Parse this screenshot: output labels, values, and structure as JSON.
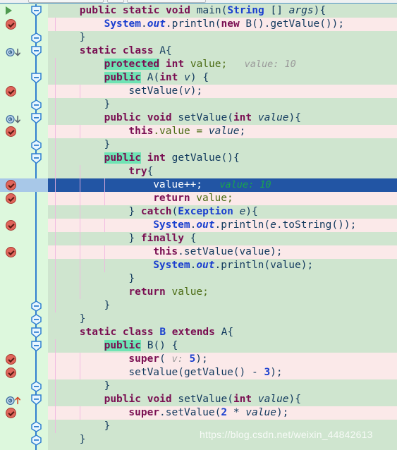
{
  "app": {
    "name": "java-code-editor",
    "theme_colors": {
      "gutter_bg": "#ddf8dd",
      "code_bg": "#cfe5cf",
      "modified_line_bg": "#fbe9e9",
      "current_line_bg": "#2255a4",
      "current_line_gutter_bg": "#a8c8e8",
      "search_highlight": "#6fe3b4",
      "indent_guide": "#f0b4e0",
      "fold_ruler": "#2f7fd0",
      "breakpoint": "#e0665c"
    }
  },
  "watermark": "https://blog.csdn.net/weixin_44842613",
  "lines": [
    {
      "n": 1,
      "indent": 1,
      "bg": "normal",
      "gutter": "run-icon",
      "fold": "collapse-end",
      "guides": 0,
      "tokens": [
        {
          "t": "public",
          "c": "kw"
        },
        {
          "t": " ",
          "c": "plain"
        },
        {
          "t": "static",
          "c": "kw"
        },
        {
          "t": " ",
          "c": "plain"
        },
        {
          "t": "void",
          "c": "kw"
        },
        {
          "t": " ",
          "c": "plain"
        },
        {
          "t": "main",
          "c": "plain"
        },
        {
          "t": "(",
          "c": "plain"
        },
        {
          "t": "String",
          "c": "type"
        },
        {
          "t": " [] ",
          "c": "plain"
        },
        {
          "t": "args",
          "c": "italic plain"
        },
        {
          "t": "){",
          "c": "plain"
        }
      ]
    },
    {
      "n": 2,
      "indent": 2,
      "bg": "pink",
      "gutter": "breakpoint-icon",
      "fold": "none",
      "guides": 1,
      "tokens": [
        {
          "t": "System",
          "c": "stat"
        },
        {
          "t": ".",
          "c": "plain"
        },
        {
          "t": "out",
          "c": "stat italic"
        },
        {
          "t": ".println(",
          "c": "plain"
        },
        {
          "t": "new",
          "c": "kw"
        },
        {
          "t": " B().getValue());",
          "c": "plain"
        }
      ]
    },
    {
      "n": 3,
      "indent": 1,
      "bg": "normal",
      "gutter": "none",
      "fold": "collapse-close",
      "guides": 0,
      "tokens": [
        {
          "t": "}",
          "c": "plain"
        }
      ]
    },
    {
      "n": 4,
      "indent": 1,
      "bg": "normal",
      "gutter": "override-down-icon",
      "fold": "collapse-end",
      "guides": 0,
      "tokens": [
        {
          "t": "static",
          "c": "kw"
        },
        {
          "t": " ",
          "c": "plain"
        },
        {
          "t": "class",
          "c": "kw"
        },
        {
          "t": " A{",
          "c": "plain"
        }
      ]
    },
    {
      "n": 5,
      "indent": 2,
      "bg": "normal",
      "gutter": "none",
      "fold": "none",
      "guides": 1,
      "tokens": [
        {
          "t": "protected",
          "c": "kw hl"
        },
        {
          "t": " ",
          "c": "plain"
        },
        {
          "t": "int",
          "c": "kw"
        },
        {
          "t": " value;",
          "c": "fld"
        },
        {
          "t": "   value: 10",
          "c": "hint"
        }
      ]
    },
    {
      "n": 6,
      "indent": 2,
      "bg": "normal",
      "gutter": "none",
      "fold": "collapse-end",
      "guides": 1,
      "tokens": [
        {
          "t": "public",
          "c": "kw hl"
        },
        {
          "t": " A(",
          "c": "plain"
        },
        {
          "t": "int",
          "c": "kw"
        },
        {
          "t": " ",
          "c": "plain"
        },
        {
          "t": "v",
          "c": "italic plain"
        },
        {
          "t": ") {",
          "c": "plain"
        }
      ]
    },
    {
      "n": 7,
      "indent": 3,
      "bg": "pink",
      "gutter": "breakpoint-icon",
      "fold": "none",
      "guides": 2,
      "tokens": [
        {
          "t": "setValue(",
          "c": "plain"
        },
        {
          "t": "v",
          "c": "italic plain"
        },
        {
          "t": ");",
          "c": "plain"
        }
      ]
    },
    {
      "n": 8,
      "indent": 2,
      "bg": "normal",
      "gutter": "none",
      "fold": "collapse-close",
      "guides": 1,
      "tokens": [
        {
          "t": "}",
          "c": "plain"
        }
      ]
    },
    {
      "n": 9,
      "indent": 2,
      "bg": "normal",
      "gutter": "override-down-icon",
      "fold": "collapse-end",
      "guides": 1,
      "tokens": [
        {
          "t": "public",
          "c": "kw"
        },
        {
          "t": " ",
          "c": "plain"
        },
        {
          "t": "void",
          "c": "kw"
        },
        {
          "t": " setValue(",
          "c": "plain"
        },
        {
          "t": "int",
          "c": "kw"
        },
        {
          "t": " ",
          "c": "plain"
        },
        {
          "t": "value",
          "c": "italic plain"
        },
        {
          "t": "){",
          "c": "plain"
        }
      ]
    },
    {
      "n": 10,
      "indent": 3,
      "bg": "pink",
      "gutter": "breakpoint-icon",
      "fold": "none",
      "guides": 2,
      "tokens": [
        {
          "t": "this",
          "c": "kw"
        },
        {
          "t": ".value = ",
          "c": "fld"
        },
        {
          "t": "value",
          "c": "italic plain"
        },
        {
          "t": ";",
          "c": "plain"
        }
      ]
    },
    {
      "n": 11,
      "indent": 2,
      "bg": "normal",
      "gutter": "none",
      "fold": "collapse-close",
      "guides": 1,
      "tokens": [
        {
          "t": "}",
          "c": "plain"
        }
      ]
    },
    {
      "n": 12,
      "indent": 2,
      "bg": "normal",
      "gutter": "none",
      "fold": "collapse-end",
      "guides": 1,
      "tokens": [
        {
          "t": "public",
          "c": "kw hl"
        },
        {
          "t": " ",
          "c": "plain"
        },
        {
          "t": "int",
          "c": "kw"
        },
        {
          "t": " getValue(){",
          "c": "plain"
        }
      ]
    },
    {
      "n": 13,
      "indent": 3,
      "bg": "normal",
      "gutter": "none",
      "fold": "none",
      "guides": 2,
      "tokens": [
        {
          "t": "try",
          "c": "kw"
        },
        {
          "t": "{",
          "c": "plain"
        }
      ]
    },
    {
      "n": 14,
      "indent": 4,
      "bg": "current",
      "gutter": "breakpoint-icon",
      "fold": "none",
      "guides": 3,
      "tokens": [
        {
          "t": "value++;",
          "c": "plain"
        },
        {
          "t": "   value: 10",
          "c": "hintg"
        }
      ]
    },
    {
      "n": 15,
      "indent": 4,
      "bg": "pink",
      "gutter": "breakpoint-icon",
      "fold": "none",
      "guides": 3,
      "tokens": [
        {
          "t": "return",
          "c": "kw"
        },
        {
          "t": " value;",
          "c": "fld"
        }
      ]
    },
    {
      "n": 16,
      "indent": 3,
      "bg": "normal",
      "gutter": "none",
      "fold": "none",
      "guides": 2,
      "tokens": [
        {
          "t": "} ",
          "c": "plain"
        },
        {
          "t": "catch",
          "c": "kw"
        },
        {
          "t": "(",
          "c": "plain"
        },
        {
          "t": "Exception",
          "c": "type"
        },
        {
          "t": " ",
          "c": "plain"
        },
        {
          "t": "e",
          "c": "italic plain"
        },
        {
          "t": "){",
          "c": "plain"
        }
      ]
    },
    {
      "n": 17,
      "indent": 4,
      "bg": "pink",
      "gutter": "breakpoint-icon",
      "fold": "none",
      "guides": 3,
      "tokens": [
        {
          "t": "System",
          "c": "stat"
        },
        {
          "t": ".",
          "c": "plain"
        },
        {
          "t": "out",
          "c": "stat italic"
        },
        {
          "t": ".println(",
          "c": "plain"
        },
        {
          "t": "e",
          "c": "italic plain"
        },
        {
          "t": ".toString());",
          "c": "plain"
        }
      ]
    },
    {
      "n": 18,
      "indent": 3,
      "bg": "normal",
      "gutter": "none",
      "fold": "none",
      "guides": 2,
      "tokens": [
        {
          "t": "} ",
          "c": "plain"
        },
        {
          "t": "finally",
          "c": "kw"
        },
        {
          "t": " {",
          "c": "plain"
        }
      ]
    },
    {
      "n": 19,
      "indent": 4,
      "bg": "pink",
      "gutter": "breakpoint-icon",
      "fold": "none",
      "guides": 3,
      "tokens": [
        {
          "t": "this",
          "c": "kw"
        },
        {
          "t": ".setValue(value);",
          "c": "plain"
        }
      ]
    },
    {
      "n": 20,
      "indent": 4,
      "bg": "normal",
      "gutter": "none",
      "fold": "none",
      "guides": 3,
      "tokens": [
        {
          "t": "System",
          "c": "stat"
        },
        {
          "t": ".",
          "c": "plain"
        },
        {
          "t": "out",
          "c": "stat italic"
        },
        {
          "t": ".println(value);",
          "c": "plain"
        }
      ]
    },
    {
      "n": 21,
      "indent": 3,
      "bg": "normal",
      "gutter": "none",
      "fold": "none",
      "guides": 2,
      "tokens": [
        {
          "t": "}",
          "c": "plain"
        }
      ]
    },
    {
      "n": 22,
      "indent": 3,
      "bg": "normal",
      "gutter": "none",
      "fold": "none",
      "guides": 2,
      "tokens": [
        {
          "t": "return",
          "c": "kw"
        },
        {
          "t": " value;",
          "c": "fld"
        }
      ]
    },
    {
      "n": 23,
      "indent": 2,
      "bg": "normal",
      "gutter": "none",
      "fold": "collapse-close",
      "guides": 1,
      "tokens": [
        {
          "t": "}",
          "c": "plain"
        }
      ]
    },
    {
      "n": 24,
      "indent": 1,
      "bg": "normal",
      "gutter": "none",
      "fold": "collapse-close",
      "guides": 0,
      "tokens": [
        {
          "t": "}",
          "c": "plain"
        }
      ]
    },
    {
      "n": 25,
      "indent": 1,
      "bg": "normal",
      "gutter": "none",
      "fold": "collapse-end",
      "guides": 0,
      "tokens": [
        {
          "t": "static",
          "c": "kw"
        },
        {
          "t": " ",
          "c": "plain"
        },
        {
          "t": "class",
          "c": "kw"
        },
        {
          "t": " ",
          "c": "plain"
        },
        {
          "t": "B",
          "c": "type"
        },
        {
          "t": " ",
          "c": "plain"
        },
        {
          "t": "extends",
          "c": "kw"
        },
        {
          "t": " A{",
          "c": "plain"
        }
      ]
    },
    {
      "n": 26,
      "indent": 2,
      "bg": "normal",
      "gutter": "none",
      "fold": "collapse-end",
      "guides": 1,
      "tokens": [
        {
          "t": "public",
          "c": "kw hl"
        },
        {
          "t": " B() {",
          "c": "plain"
        }
      ]
    },
    {
      "n": 27,
      "indent": 3,
      "bg": "pink",
      "gutter": "breakpoint-icon",
      "fold": "none",
      "guides": 2,
      "tokens": [
        {
          "t": "super",
          "c": "kw"
        },
        {
          "t": "( ",
          "c": "plain"
        },
        {
          "t": "v:",
          "c": "hint"
        },
        {
          "t": " ",
          "c": "plain"
        },
        {
          "t": "5",
          "c": "num"
        },
        {
          "t": ");",
          "c": "plain"
        }
      ]
    },
    {
      "n": 28,
      "indent": 3,
      "bg": "pink",
      "gutter": "breakpoint-icon",
      "fold": "none",
      "guides": 2,
      "tokens": [
        {
          "t": "setValue(getValue() - ",
          "c": "plain"
        },
        {
          "t": "3",
          "c": "num"
        },
        {
          "t": ");",
          "c": "plain"
        }
      ]
    },
    {
      "n": 29,
      "indent": 2,
      "bg": "normal",
      "gutter": "none",
      "fold": "collapse-close",
      "guides": 1,
      "tokens": [
        {
          "t": "}",
          "c": "plain"
        }
      ]
    },
    {
      "n": 30,
      "indent": 2,
      "bg": "normal",
      "gutter": "override-up-icon",
      "fold": "collapse-end",
      "guides": 1,
      "tokens": [
        {
          "t": "public",
          "c": "kw"
        },
        {
          "t": " ",
          "c": "plain"
        },
        {
          "t": "void",
          "c": "kw"
        },
        {
          "t": " setValue(",
          "c": "plain"
        },
        {
          "t": "int",
          "c": "kw"
        },
        {
          "t": " ",
          "c": "plain"
        },
        {
          "t": "value",
          "c": "italic plain"
        },
        {
          "t": "){",
          "c": "plain"
        }
      ]
    },
    {
      "n": 31,
      "indent": 3,
      "bg": "pink",
      "gutter": "breakpoint-icon",
      "fold": "none",
      "guides": 2,
      "tokens": [
        {
          "t": "super",
          "c": "kw"
        },
        {
          "t": ".setValue(",
          "c": "plain"
        },
        {
          "t": "2",
          "c": "num"
        },
        {
          "t": " * ",
          "c": "plain"
        },
        {
          "t": "value",
          "c": "italic plain"
        },
        {
          "t": ");",
          "c": "plain"
        }
      ]
    },
    {
      "n": 32,
      "indent": 2,
      "bg": "normal",
      "gutter": "none",
      "fold": "collapse-close",
      "guides": 1,
      "tokens": [
        {
          "t": "}",
          "c": "plain"
        }
      ]
    },
    {
      "n": 33,
      "indent": 1,
      "bg": "normal",
      "gutter": "none",
      "fold": "collapse-close",
      "guides": 0,
      "tokens": [
        {
          "t": "}",
          "c": "plain"
        }
      ]
    }
  ]
}
